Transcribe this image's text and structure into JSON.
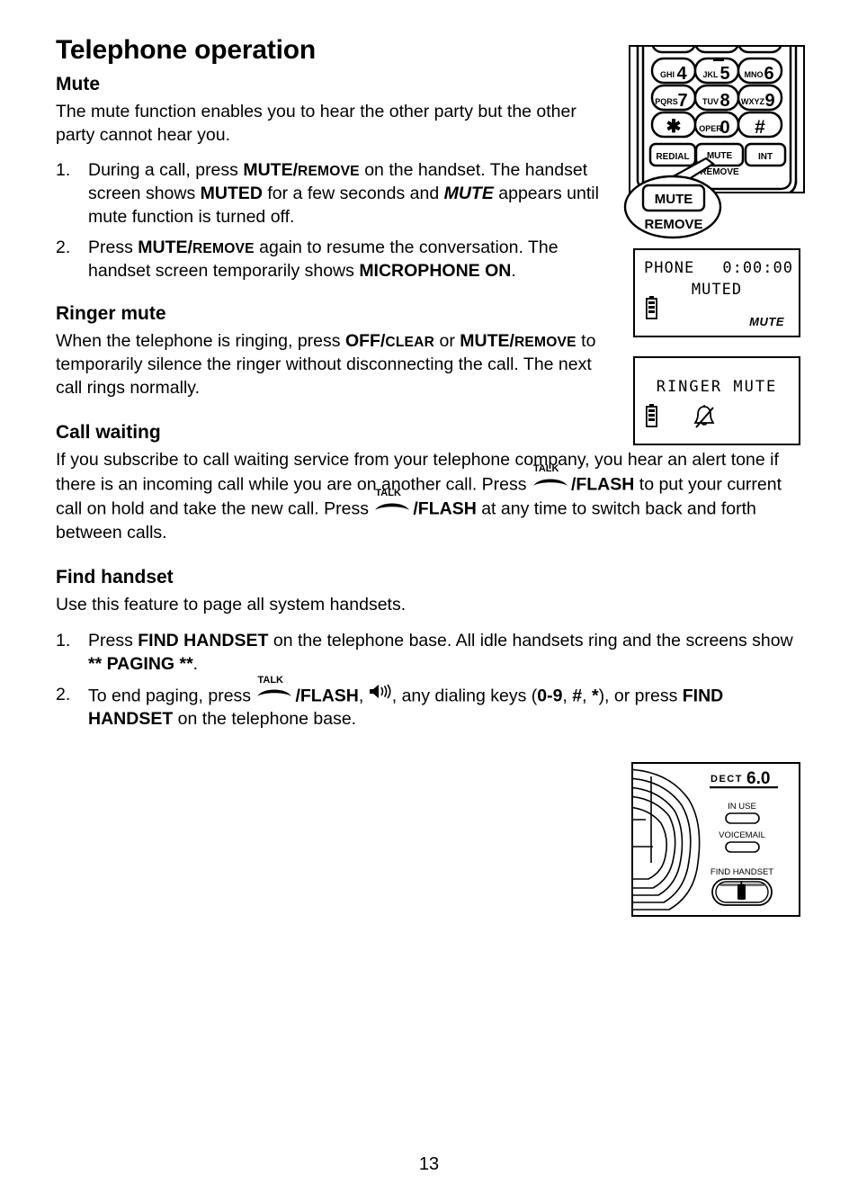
{
  "document": {
    "page_title": "Telephone operation",
    "page_number": "13"
  },
  "sections": {
    "mute": {
      "heading": "Mute",
      "intro": "The mute function enables you to hear the other party but the other party cannot hear you.",
      "steps": [
        {
          "num": "1.",
          "parts": {
            "t1": "During a call, press ",
            "b1": "MUTE/",
            "sc1": "REMOVE",
            "t2": " on the handset. The handset screen shows ",
            "b2": "MUTED",
            "t3": " for a few seconds and ",
            "bi1": "MUTE",
            "t4": "  appears until mute function is turned off."
          }
        },
        {
          "num": "2.",
          "parts": {
            "t1": "Press ",
            "b1": "MUTE/",
            "sc1": "REMOVE",
            "t2": " again to resume the conversation. The handset screen temporarily shows ",
            "b2": "MICROPHONE ON",
            "t3": "."
          }
        }
      ]
    },
    "ringer_mute": {
      "heading": "Ringer mute",
      "body": {
        "t1": "When the telephone is ringing, press ",
        "b1": "OFF/",
        "sc1": "CLEAR",
        "t2": " or ",
        "b2": "MUTE/",
        "sc2": "REMOVE",
        "t3": " to temporarily silence the ringer without disconnecting the call. The next call rings normally."
      }
    },
    "call_waiting": {
      "heading": "Call waiting",
      "body": {
        "t1": "If you subscribe to call waiting service from your telephone company, you hear an alert tone if there is an incoming call while you are on another call. Press ",
        "talk1": "TALK",
        "b1": "/FLASH",
        "t2": " to put your current call on hold and take the new call. Press ",
        "talk2": "TALK",
        "b2": "/FLASH",
        "t3": " at any time to switch back and forth between calls."
      }
    },
    "find_handset": {
      "heading": "Find handset",
      "intro": "Use this feature to page all system handsets.",
      "steps": [
        {
          "num": "1.",
          "parts": {
            "t1": "Press ",
            "b1": "FIND HANDSET",
            "t2": " on the telephone base. All idle handsets ring and the screens show ",
            "b2": "** PAGING **",
            "t3": "."
          }
        },
        {
          "num": "2.",
          "parts": {
            "t1": "To end paging, press ",
            "talk1": "TALK",
            "b1": "/FLASH",
            "t2": ", ",
            "speaker": "speaker-icon",
            "t3": ", any dialing keys (",
            "b2": "0-9",
            "t4": ", ",
            "b3": "#",
            "t5": ", ",
            "b4": "*",
            "t6": "), or press ",
            "b5": "FIND HANDSET",
            "t7": " on the telephone base."
          }
        }
      ]
    }
  },
  "figures": {
    "keypad": {
      "name": "handset-keypad-illustration",
      "keys": [
        {
          "letters": "GHI",
          "digit": "4"
        },
        {
          "letters": "JKL",
          "digit": "5"
        },
        {
          "letters": "MNO",
          "digit": "6"
        },
        {
          "letters": "PQRS",
          "digit": "7"
        },
        {
          "letters": "TUV",
          "digit": "8"
        },
        {
          "letters": "WXYZ",
          "digit": "9"
        },
        {
          "letters": "",
          "digit": "✳"
        },
        {
          "letters": "OPER",
          "digit": "0"
        },
        {
          "letters": "",
          "digit": "#"
        }
      ],
      "function_keys": [
        {
          "label": "REDIAL"
        },
        {
          "label": "MUTE",
          "sublabel": "REMOVE"
        },
        {
          "label": "INT"
        }
      ],
      "callout": {
        "label": "MUTE",
        "sublabel": "REMOVE"
      }
    },
    "lcd_muted": {
      "name": "handset-screen-muted",
      "line1_left": "PHONE",
      "line1_right": "0:00:00",
      "line2": "MUTED",
      "indicator": "MUTE",
      "icons": [
        "battery-icon"
      ]
    },
    "lcd_ringer_mute": {
      "name": "handset-screen-ringer-mute",
      "line1": "RINGER MUTE",
      "icons": [
        "battery-icon",
        "bell-mute-icon"
      ]
    },
    "base": {
      "name": "telephone-base-illustration",
      "logo_prefix": "DECT",
      "logo_version": "6.0",
      "leds": [
        {
          "label": "IN USE"
        },
        {
          "label": "VOICEMAIL"
        }
      ],
      "button": {
        "label": "FIND HANDSET",
        "icon": "handset-icon"
      }
    }
  }
}
